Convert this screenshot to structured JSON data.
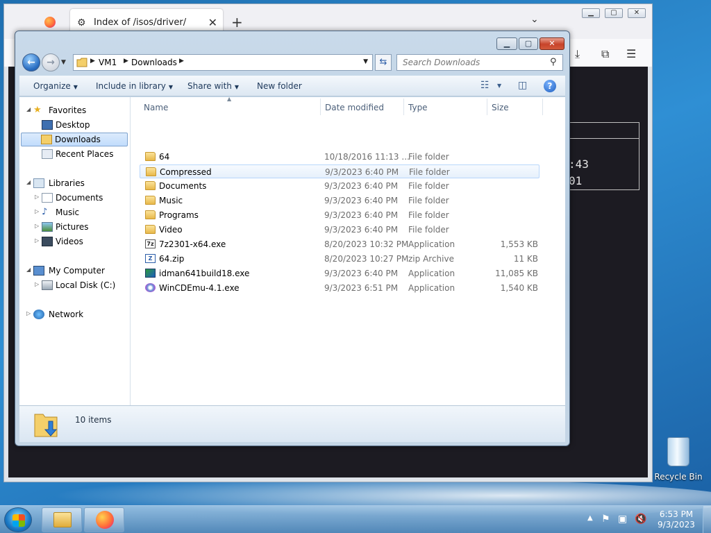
{
  "browser": {
    "tab_title": "Index of /isos/driver/",
    "content_values": [
      ":43",
      "01"
    ]
  },
  "explorer": {
    "breadcrumb": [
      "VM1",
      "Downloads"
    ],
    "search_placeholder": "Search Downloads",
    "commands": {
      "organize": "Organize",
      "include_in_library": "Include in library",
      "share_with": "Share with",
      "new_folder": "New folder"
    },
    "nav": {
      "favorites": "Favorites",
      "desktop": "Desktop",
      "downloads": "Downloads",
      "recent_places": "Recent Places",
      "libraries": "Libraries",
      "documents": "Documents",
      "music": "Music",
      "pictures": "Pictures",
      "videos": "Videos",
      "my_computer": "My Computer",
      "local_disk": "Local Disk (C:)",
      "network": "Network"
    },
    "columns": {
      "name": "Name",
      "date": "Date modified",
      "type": "Type",
      "size": "Size"
    },
    "files": [
      {
        "name": "64",
        "date": "10/18/2016 11:13 ...",
        "type": "File folder",
        "size": ""
      },
      {
        "name": "Compressed",
        "date": "9/3/2023 6:40 PM",
        "type": "File folder",
        "size": ""
      },
      {
        "name": "Documents",
        "date": "9/3/2023 6:40 PM",
        "type": "File folder",
        "size": ""
      },
      {
        "name": "Music",
        "date": "9/3/2023 6:40 PM",
        "type": "File folder",
        "size": ""
      },
      {
        "name": "Programs",
        "date": "9/3/2023 6:40 PM",
        "type": "File folder",
        "size": ""
      },
      {
        "name": "Video",
        "date": "9/3/2023 6:40 PM",
        "type": "File folder",
        "size": ""
      },
      {
        "name": "7z2301-x64.exe",
        "date": "8/20/2023 10:32 PM",
        "type": "Application",
        "size": "1,553 KB"
      },
      {
        "name": "64.zip",
        "date": "8/20/2023 10:27 PM",
        "type": "zip Archive",
        "size": "11 KB"
      },
      {
        "name": "idman641build18.exe",
        "date": "9/3/2023 6:40 PM",
        "type": "Application",
        "size": "11,085 KB"
      },
      {
        "name": "WinCDEmu-4.1.exe",
        "date": "9/3/2023 6:51 PM",
        "type": "Application",
        "size": "1,540 KB"
      }
    ],
    "status": "10 items"
  },
  "desktop": {
    "recycle_bin": "Recycle Bin"
  },
  "taskbar": {
    "time": "6:53 PM",
    "date": "9/3/2023"
  },
  "colors": {
    "accent": "#1e395b",
    "selection_border": "#7da2ce",
    "hover_border": "#b8d6fb"
  }
}
